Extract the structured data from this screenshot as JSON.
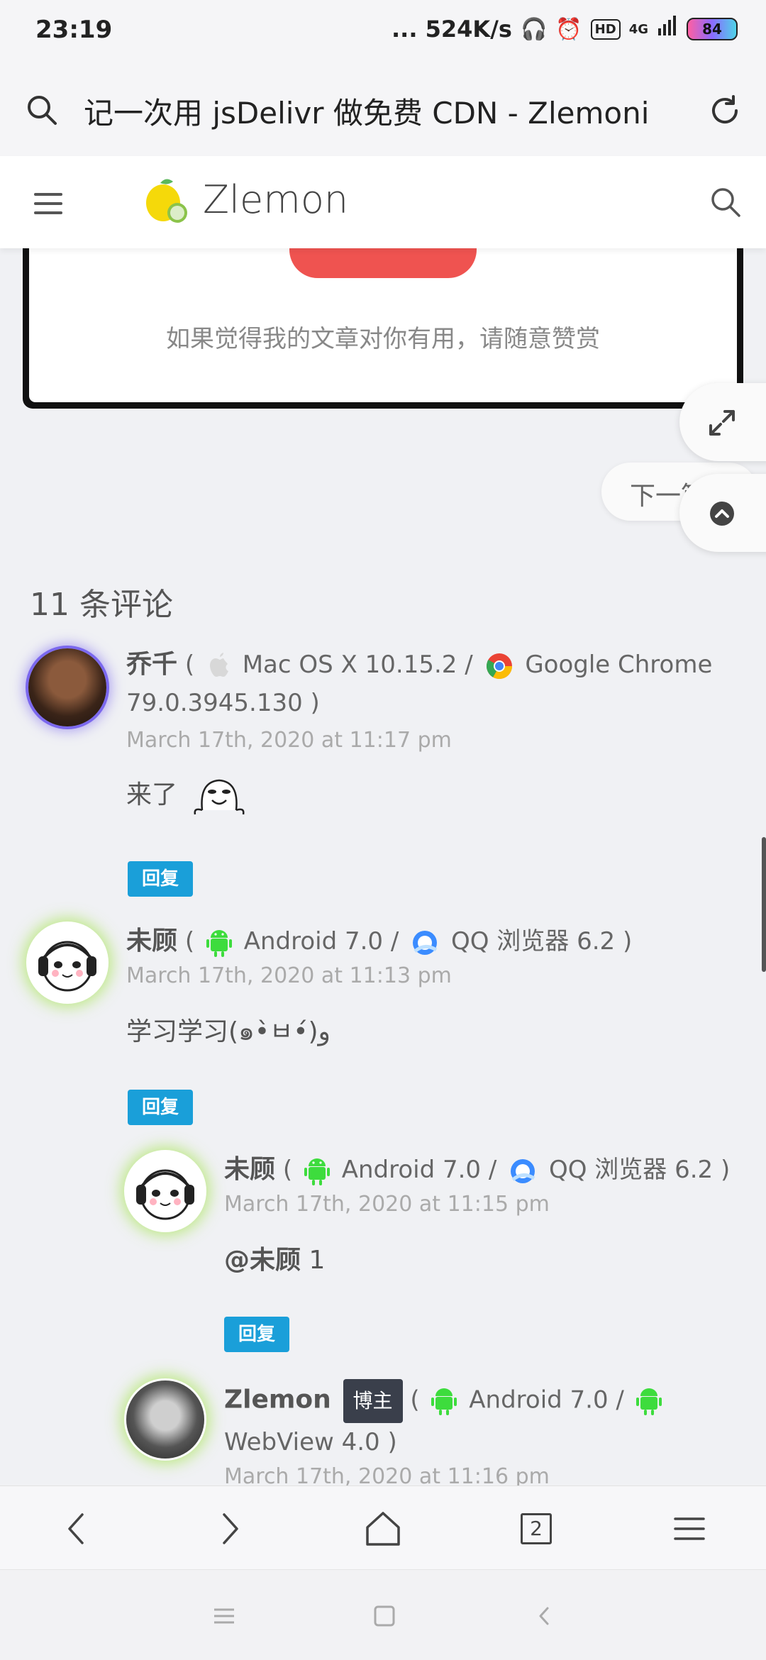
{
  "status_bar": {
    "time": "23:19",
    "network_speed": "... 524K/s",
    "hd_label": "HD",
    "network_type": "4G",
    "battery": "84"
  },
  "browser": {
    "page_title": "记一次用 jsDelivr 做免费 CDN - Zlemoni",
    "tab_count": "2"
  },
  "site": {
    "logo_text": "Zlemon"
  },
  "reward": {
    "note": "如果觉得我的文章对你有用，请随意赞赏"
  },
  "next_post_label": "下一篇",
  "comments": {
    "title": "11 条评论",
    "reply_label": "回复",
    "admin_label": "博主",
    "items": [
      {
        "author": "乔千",
        "os": "Mac OS X 10.15.2 /",
        "browser": "Google Chrome",
        "browser_version": "79.0.3945.130 )",
        "date": "March 17th, 2020 at 11:17 pm",
        "text": "来了"
      },
      {
        "author": "未顾",
        "os": "Android 7.0 /",
        "browser": "QQ 浏览器 6.2 )",
        "date": "March 17th, 2020 at 11:13 pm",
        "text": "学习学习(๑•̀ㅂ•́)و"
      },
      {
        "author": "未顾",
        "os": "Android 7.0 /",
        "browser": "QQ 浏览器 6.2 )",
        "date": "March 17th, 2020 at 11:15 pm",
        "mention": "@未顾",
        "text": "1"
      },
      {
        "author": "Zlemon",
        "os": "Android 7.0 /",
        "browser": "WebView 4.0 )",
        "date": "March 17th, 2020 at 11:16 pm"
      }
    ]
  },
  "colors": {
    "reply_blue": "#1a9fd9",
    "reward_red": "#ef5350",
    "android_green": "#3ddc3d"
  }
}
